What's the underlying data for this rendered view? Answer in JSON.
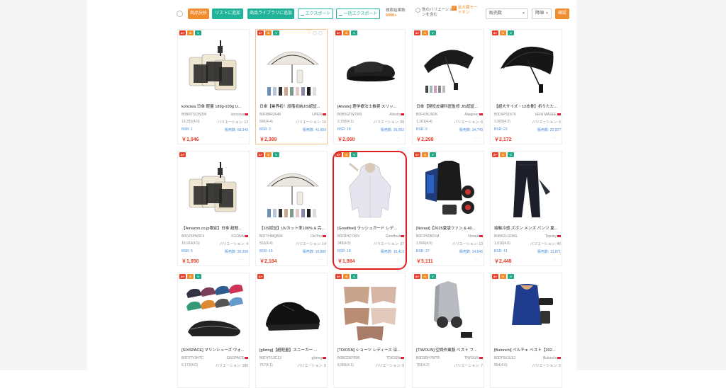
{
  "toolbar": {
    "btn_product_analysis": "商品分析",
    "btn_add_to_list": "リストに追加",
    "btn_add_to_library": "商品ライブラリに追加",
    "btn_export": "エクスポート",
    "btn_bulk_export": "一括エクスポート",
    "result_count_label": "検索結果数:",
    "result_count_value": "5000+",
    "other_variations_label": "他のバリエーションを含む",
    "zoom_mode_label": "拡大図モードオン",
    "sort_select": "販売数",
    "order_select": "降順",
    "confirm_button": "確認"
  },
  "colors": {
    "accent_orange": "#f08c2e",
    "accent_teal": "#1fb39a",
    "price_red": "#e8412c",
    "bsr_blue": "#4a8fdb",
    "highlight": "#e01e1e"
  },
  "products": [
    {
      "title": "konciwa 日傘 軽量 189g-199g U...",
      "asin": "B0BRTSCW2W",
      "brand": "konciwa",
      "rating": "13,331(4.0)",
      "variations": "バリエーション: 12",
      "bsr": "BSR: 1",
      "sales": "販売数: 68,349",
      "price": "￥1,946",
      "badges": [
        "A+",
        "S",
        "V"
      ],
      "image": "umbrella-pouch"
    },
    {
      "title": "日傘【業界初！段階収納JIS認証...",
      "asin": "B0F8BR2648",
      "brand": "UPER",
      "rating": "666(4.4)",
      "variations": "バリエーション: 16",
      "bsr": "BSR: 3",
      "sales": "販売数: 41,659",
      "price": "￥2,389",
      "badges": [
        "A+",
        "S",
        "V"
      ],
      "image": "umbrella-white"
    },
    {
      "title": "[Alvisto] 理学療法士推奨 スリッ...",
      "asin": "B0B5GTW7W9",
      "brand": "Alvisto",
      "rating": "2,158(4.1)",
      "variations": "バリエーション: 99",
      "bsr": "BSR: 18",
      "sales": "販売数: 26,092",
      "price": "￥2,060",
      "badges": [
        "A+",
        "S",
        "V"
      ],
      "image": "slipper"
    },
    {
      "title": "日傘【現役皮膚科医監修 JIS認証...",
      "asin": "B0F43KJ9DK",
      "brand": "Alwgreer",
      "rating": "1,161(4.4)",
      "variations": "バリエーション: 6",
      "bsr": "BSR: 9",
      "sales": "販売数: 34,749",
      "price": "￥2,298",
      "badges": [
        "A+",
        "S",
        "V"
      ],
      "image": "umbrella-black-open"
    },
    {
      "title": "【超大サイズ・12本骨】折りたた...",
      "asin": "B0D9PS1K76",
      "brand": "VENI MASEE",
      "rating": "2,903(4.2)",
      "variations": "バリエーション: 6",
      "bsr": "BSR: 23",
      "sales": "販売数: 20,927",
      "price": "￥2,172",
      "badges": [
        "A+",
        "S",
        "V"
      ],
      "image": "umbrella-black"
    },
    {
      "title": "【Amazon.co.jp限定】日傘 超軽...",
      "asin": "B0DZ5PW9F4",
      "brand": "FGONA",
      "rating": "16,919(4.5)",
      "variations": "バリエーション: 4",
      "bsr": "BSR: 5",
      "sales": "販売数: 30,358",
      "price": "￥1,950",
      "badges": [
        "A+"
      ],
      "image": "umbrella-pouch"
    },
    {
      "title": "【JIS認証】UVカット率100% & 完...",
      "asin": "B0FTHMQB44",
      "brand": "DelTrio",
      "rating": "553(4.4)",
      "variations": "バリエーション: 14",
      "bsr": "BSR: 15",
      "sales": "販売数: 16,880",
      "price": "￥2,184",
      "badges": [
        "A+",
        "S",
        "V"
      ],
      "image": "umbrella-white"
    },
    {
      "title": "[Goodfeel] ラッシュガード レデ...",
      "asin": "B0FBHZ7X8V",
      "brand": "Goodfeel",
      "rating": "349(4.5)",
      "variations": "バリエーション: 37",
      "bsr": "BSR: 18",
      "sales": "販売数: 16,413",
      "price": "￥1,984",
      "badges": [
        "A+",
        "S",
        "V"
      ],
      "image": "hoodie"
    },
    {
      "title": "[Noraui]【2025夏版ファン & 40...",
      "asin": "B0F3HZBD1M",
      "brand": "Noraui",
      "rating": "1,566(4.5)",
      "variations": "バリエーション: 13",
      "bsr": "BSR: 37",
      "sales": "販売数: 14,646",
      "price": "￥5,111",
      "badges": [
        "A+",
        "S",
        "V"
      ],
      "image": "vest-fan"
    },
    {
      "title": "接触冷感 ズボン メンズ パンツ 夏...",
      "asin": "B0BK2LGD8G",
      "brand": "Topoky",
      "rating": "1,016(4.0)",
      "variations": "バリエーション: 40",
      "bsr": "BSR: 41",
      "sales": "販売数: 13,871",
      "price": "￥2,448",
      "badges": [
        "A+",
        "S",
        "V"
      ],
      "image": "pants"
    },
    {
      "title": "[SIXSPACE] マリンシューズ ウォ...",
      "asin": "B0F3TY3H7C",
      "brand": "SIXSPACE",
      "rating": "6,173(4.0)",
      "variations": "バリエーション: 180",
      "bsr": "",
      "sales": "",
      "price": "",
      "badges": [
        "A+",
        "S",
        "V"
      ],
      "image": "shoes"
    },
    {
      "title": "[gltzing]【超軽量】スニーカー ...",
      "asin": "B0DYF13C13",
      "brand": "gltzing",
      "rating": "757(4.1)",
      "variations": "バリエーション: 6",
      "bsr": "",
      "sales": "",
      "price": "",
      "badges": [
        "A+"
      ],
      "image": "sneaker"
    },
    {
      "title": "[TDIOSN] ショーツ レディース 深...",
      "asin": "B0BCD6FR96",
      "brand": "TDIOSN",
      "rating": "6,966(4.1)",
      "variations": "バリエーション: 8",
      "bsr": "",
      "sales": "",
      "price": "",
      "badges": [
        "A+",
        "S",
        "V"
      ],
      "image": "shorts"
    },
    {
      "title": "[TIWOUN] 空調作業服 ベスト フ...",
      "asin": "B0D3RH7M7R",
      "brand": "TIWOUN",
      "rating": "753(4.2)",
      "variations": "バリエーション: 7",
      "bsr": "",
      "sales": "",
      "price": "",
      "badges": [
        "A+",
        "S",
        "V"
      ],
      "image": "work-vest"
    },
    {
      "title": "[Bulonchi] ベルチェ ベスト【202...",
      "asin": "B0DF9X3L5J",
      "brand": "Bulonchi",
      "rating": "864(4.0)",
      "variations": "バリエーション: 5",
      "bsr": "",
      "sales": "",
      "price": "",
      "badges": [
        "A+",
        "S",
        "V"
      ],
      "image": "cool-vest"
    }
  ]
}
